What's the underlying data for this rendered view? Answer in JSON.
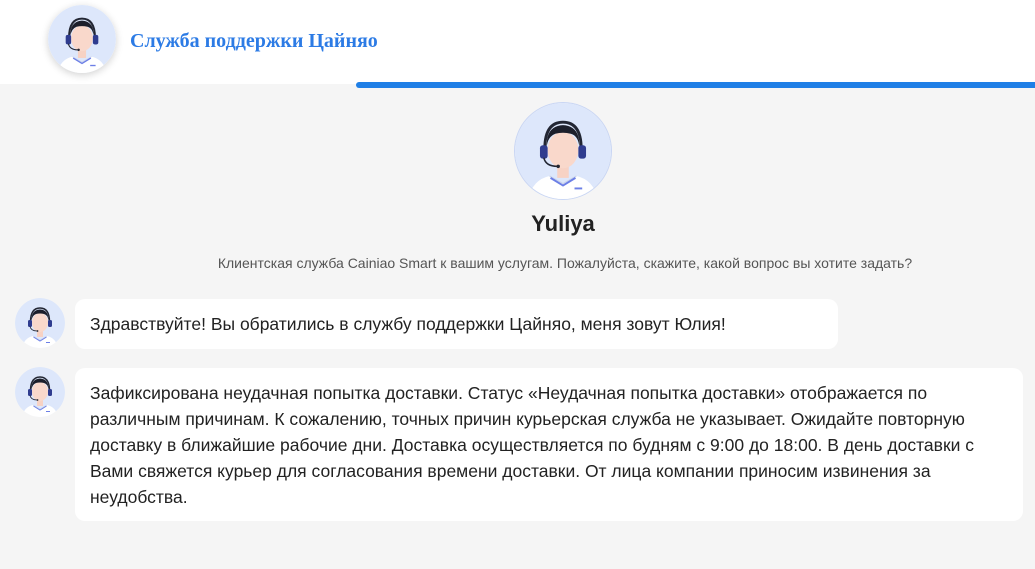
{
  "header": {
    "title": "Служба поддержки Цайняо"
  },
  "agent": {
    "name": "Yuliya",
    "intro": "Клиентская служба Cainiao Smart к вашим услугам. Пожалуйста, скажите, какой вопрос вы хотите задать?"
  },
  "messages": [
    {
      "text": "Здравствуйте! Вы обратились в службу поддержки Цайняо, меня зовут Юлия!"
    },
    {
      "text": "Зафиксирована неудачная попытка доставки. Статус «Неудачная попытка доставки» отображается по различным причинам. К сожалению, точных причин курьерская служба не указывает. Ожидайте повторную доставку в ближайшие рабочие дни. Доставка осуществляется по будням с 9:00 до 18:00. В день доставки с Вами свяжется курьер для согласования времени доставки. От лица компании приносим извинения за неудобства."
    }
  ],
  "colors": {
    "accent": "#1f7fe6",
    "title": "#2c7be5",
    "background": "#f5f5f5"
  },
  "icons": {
    "avatar": "support-agent-avatar-icon"
  }
}
